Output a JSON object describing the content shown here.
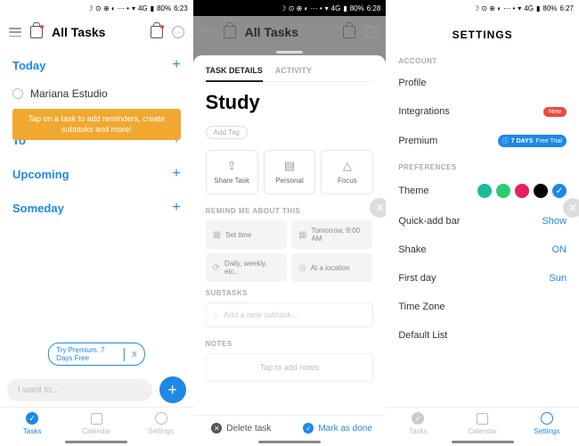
{
  "status": {
    "battery": "80%",
    "time1": "6:23",
    "time2": "6:28",
    "time3": "6:27",
    "net": "4G"
  },
  "s1": {
    "title": "All Tasks",
    "sections": [
      "Today",
      "Tomorrow",
      "Upcoming",
      "Someday"
    ],
    "task": "Mariana Estudio",
    "tooltip": "Tap on a task to add reminders, create subtasks and more!",
    "premium": "Try Premium. 7 Days Free",
    "premium_x": "X",
    "input_ph": "I want to...",
    "tabs": [
      "Tasks",
      "Calendar",
      "Settings"
    ]
  },
  "s2": {
    "hdr": "All Tasks",
    "tabs": [
      "TASK DETAILS",
      "ACTIVITY"
    ],
    "title": "Study",
    "addtag": "Add Tag",
    "actions": [
      "Share Task",
      "Personal",
      "Focus"
    ],
    "remind_label": "REMIND ME ABOUT THIS",
    "reminders": [
      "Set time",
      "Tomorrow, 9:00 AM",
      "Daily, weekly, etc..",
      "At a location"
    ],
    "subtasks_label": "SUBTASKS",
    "subtask_ph": "Add a new subtask...",
    "notes_label": "NOTES",
    "notes_ph": "Tap to add notes",
    "delete": "Delete task",
    "done": "Mark as done"
  },
  "s3": {
    "title": "SETTINGS",
    "account_label": "ACCOUNT",
    "account": [
      "Profile",
      "Integrations",
      "Premium"
    ],
    "new_badge": "New",
    "trial": "7 DAYS",
    "trial2": "Free Trial",
    "prefs_label": "PREFERENCES",
    "theme": "Theme",
    "colors": [
      "#1abc9c",
      "#2ecc71",
      "#e91e63",
      "#000000",
      "#1e88e5"
    ],
    "rows": [
      {
        "l": "Quick-add bar",
        "v": "Show"
      },
      {
        "l": "Shake",
        "v": "ON"
      },
      {
        "l": "First day",
        "v": "Sun"
      },
      {
        "l": "Time Zone",
        "v": ""
      },
      {
        "l": "Default List",
        "v": ""
      }
    ],
    "tabs": [
      "Tasks",
      "Calendar",
      "Settings"
    ]
  }
}
